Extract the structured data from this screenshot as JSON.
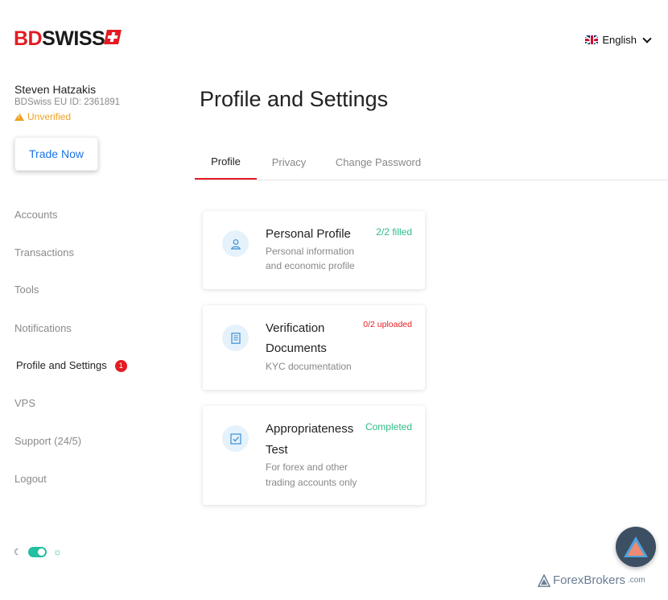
{
  "logo": {
    "part1": "BD",
    "part2": "SWISS"
  },
  "language": {
    "label": "English",
    "flag": "uk-flag-icon"
  },
  "user": {
    "name": "Steven Hatzakis",
    "account_id": "BDSwiss EU ID: 2361891",
    "status": "Unverified"
  },
  "trade_button": "Trade Now",
  "sidebar": {
    "items": [
      {
        "label": "Accounts"
      },
      {
        "label": "Transactions"
      },
      {
        "label": "Tools"
      },
      {
        "label": "Notifications"
      },
      {
        "label": "Profile and Settings",
        "badge": "1"
      },
      {
        "label": "VPS"
      },
      {
        "label": "Support (24/5)"
      },
      {
        "label": "Logout"
      }
    ]
  },
  "theme_toggle": {
    "moon": "☾",
    "sun": "☼",
    "state": "on"
  },
  "main": {
    "title": "Profile and Settings",
    "tabs": [
      {
        "label": "Profile"
      },
      {
        "label": "Privacy"
      },
      {
        "label": "Change Password"
      }
    ],
    "cards": [
      {
        "title": "Personal Profile",
        "desc1": "Personal information",
        "desc2": "and economic profile",
        "status": "2/2 filled",
        "icon": "user-icon"
      },
      {
        "title1": "Verification",
        "title2": "Documents",
        "desc1": "KYC documentation",
        "status": "0/2 uploaded",
        "icon": "document-icon"
      },
      {
        "title1": "Appropriateness",
        "title2": "Test",
        "desc1": "For forex and other",
        "desc2": "trading accounts only",
        "status": "Completed",
        "icon": "checkbox-icon"
      }
    ]
  },
  "colors": {
    "brand_red": "#e31c23",
    "link_blue": "#1a73e8",
    "success_green": "#2ebd85",
    "warning_orange": "#f0a020",
    "icon_blue": "#3a8fd6"
  },
  "watermark": {
    "brand": "ForexBrokers",
    "domain": ".com"
  }
}
